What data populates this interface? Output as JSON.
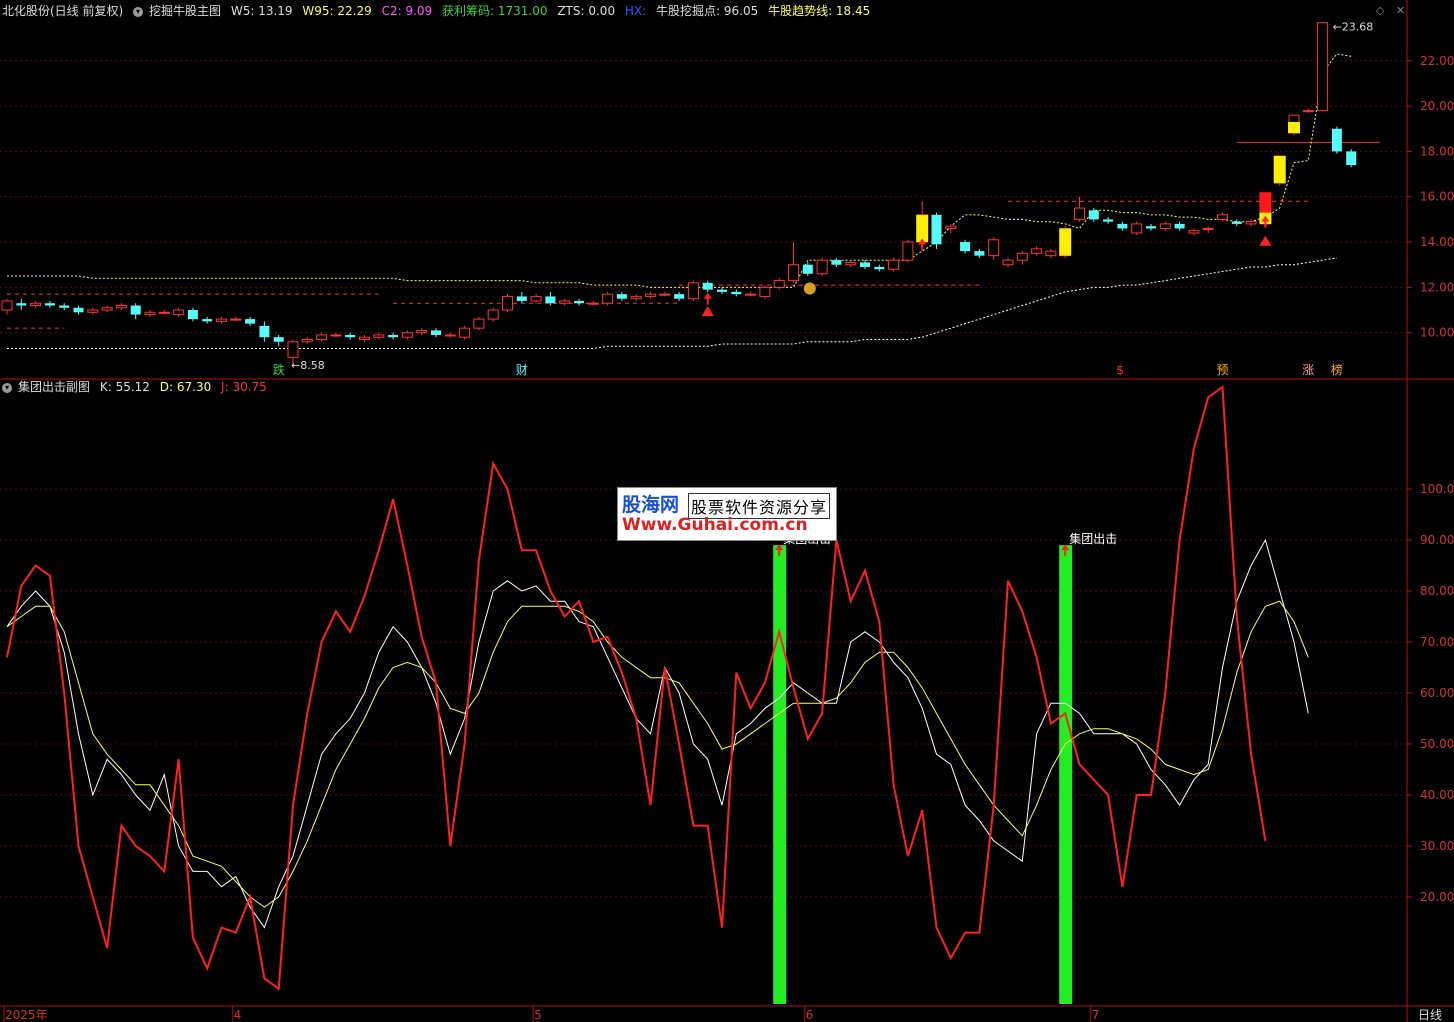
{
  "main_header": {
    "stock": "北化股份(日线 前复权)",
    "indicator": "挖掘牛股主图",
    "w5": "W5: 13.19",
    "w95": "W95: 22.29",
    "c2": "C2: 9.09",
    "chip": "获利筹码: 1731.00",
    "zts": "ZTS: 0.00",
    "hx": "HX: ",
    "dig": "牛股挖掘点: 96.05",
    "trend": "牛股趋势线: 18.45"
  },
  "sub_header": {
    "indicator": "集团出击副图",
    "k": "K: 55.12",
    "d": "D: 67.30",
    "j": "J: 30.75"
  },
  "colors": {
    "up": "#ff3030",
    "down": "#54fcfc",
    "k": "#ffffff",
    "d": "#ffff54",
    "j": "#ff2020",
    "signal": "#22ee22",
    "axis": "#b01010"
  },
  "main_axis": {
    "ticks": [
      "22.00",
      "20.00",
      "18.00",
      "16.00",
      "14.00",
      "12.00",
      "10.00"
    ],
    "values": [
      22,
      20,
      18,
      16,
      14,
      12,
      10
    ],
    "min": 8.0,
    "max": 23.8
  },
  "sub_axis": {
    "ticks": [
      "100.00",
      "90.00",
      "80.00",
      "70.00",
      "60.00",
      "50.00",
      "40.00",
      "30.00",
      "20.00"
    ],
    "values": [
      100,
      90,
      80,
      70,
      60,
      50,
      40,
      30,
      20
    ],
    "min": -1,
    "max": 121
  },
  "x_axis": {
    "labels": [
      "2025年",
      "4",
      "5",
      "6",
      "7"
    ],
    "label_index": [
      0,
      16,
      37,
      56,
      76
    ],
    "period": "日线"
  },
  "annotations": {
    "high": "23.68",
    "low": "8.58",
    "signal": "集团出击"
  },
  "markers": [
    {
      "index": 19,
      "text": "跌",
      "color": "#3cd23c"
    },
    {
      "index": 36,
      "text": "财",
      "color": "#54fcfc"
    },
    {
      "index": 78,
      "text": "$",
      "color": "#ff3030"
    },
    {
      "index": 85,
      "text": "预",
      "color": "#ffb000"
    },
    {
      "index": 91,
      "text": "涨",
      "color": "#ff9090"
    },
    {
      "index": 93,
      "text": "榜",
      "color": "#ffb000"
    }
  ],
  "logo": {
    "brand": "股海网",
    "slogan": "股票软件资源分享",
    "url": "Www.Guhai.com.cn"
  },
  "chart_data": [
    {
      "type": "candlestick",
      "title": "挖掘牛股主图",
      "candles": [
        [
          11.0,
          11.4,
          11.5,
          10.8
        ],
        [
          11.3,
          11.2,
          11.5,
          11.0
        ],
        [
          11.2,
          11.3,
          11.4,
          11.1
        ],
        [
          11.3,
          11.2,
          11.4,
          11.1
        ],
        [
          11.2,
          11.1,
          11.3,
          11.0
        ],
        [
          11.1,
          10.9,
          11.2,
          10.8
        ],
        [
          10.9,
          11.0,
          11.1,
          10.8
        ],
        [
          11.0,
          11.1,
          11.2,
          10.9
        ],
        [
          11.1,
          11.2,
          11.3,
          11.0
        ],
        [
          11.2,
          10.8,
          11.3,
          10.6
        ],
        [
          10.8,
          10.9,
          11.0,
          10.7
        ],
        [
          10.9,
          10.9,
          11.0,
          10.8
        ],
        [
          10.8,
          11.0,
          11.1,
          10.7
        ],
        [
          11.0,
          10.6,
          11.1,
          10.5
        ],
        [
          10.6,
          10.5,
          10.7,
          10.4
        ],
        [
          10.5,
          10.6,
          10.7,
          10.4
        ],
        [
          10.6,
          10.6,
          10.7,
          10.5
        ],
        [
          10.6,
          10.4,
          10.7,
          10.3
        ],
        [
          10.3,
          9.8,
          10.5,
          9.6
        ],
        [
          9.8,
          9.6,
          9.9,
          9.4
        ],
        [
          8.9,
          9.6,
          9.7,
          8.6
        ],
        [
          9.6,
          9.7,
          9.8,
          9.5
        ],
        [
          9.7,
          9.9,
          10.0,
          9.6
        ],
        [
          9.9,
          9.9,
          10.0,
          9.8
        ],
        [
          9.9,
          9.8,
          10.0,
          9.7
        ],
        [
          9.7,
          9.8,
          9.9,
          9.6
        ],
        [
          9.8,
          9.9,
          10.0,
          9.7
        ],
        [
          9.9,
          9.8,
          10.0,
          9.7
        ],
        [
          9.8,
          10.0,
          10.1,
          9.7
        ],
        [
          10.0,
          10.1,
          10.2,
          9.9
        ],
        [
          10.1,
          9.9,
          10.2,
          9.8
        ],
        [
          9.9,
          9.9,
          10.0,
          9.8
        ],
        [
          9.8,
          10.2,
          10.3,
          9.7
        ],
        [
          10.2,
          10.6,
          10.7,
          10.1
        ],
        [
          10.6,
          11.0,
          11.1,
          10.5
        ],
        [
          11.0,
          11.6,
          11.7,
          10.9
        ],
        [
          11.6,
          11.4,
          11.8,
          11.3
        ],
        [
          11.4,
          11.6,
          11.7,
          11.3
        ],
        [
          11.6,
          11.3,
          11.8,
          11.2
        ],
        [
          11.3,
          11.4,
          11.5,
          11.2
        ],
        [
          11.4,
          11.3,
          11.5,
          11.2
        ],
        [
          11.3,
          11.3,
          11.4,
          11.2
        ],
        [
          11.3,
          11.7,
          11.8,
          11.2
        ],
        [
          11.7,
          11.5,
          11.8,
          11.4
        ],
        [
          11.5,
          11.6,
          11.7,
          11.4
        ],
        [
          11.6,
          11.7,
          11.8,
          11.5
        ],
        [
          11.7,
          11.7,
          11.8,
          11.6
        ],
        [
          11.7,
          11.5,
          11.8,
          11.4
        ],
        [
          11.5,
          12.2,
          12.3,
          11.4
        ],
        [
          12.2,
          11.9,
          12.3,
          11.8
        ],
        [
          11.9,
          11.8,
          12.0,
          11.7
        ],
        [
          11.8,
          11.7,
          11.9,
          11.6
        ],
        [
          11.7,
          11.7,
          11.8,
          11.6
        ],
        [
          11.6,
          12.0,
          12.1,
          11.5
        ],
        [
          12.0,
          12.3,
          12.4,
          11.9
        ],
        [
          12.3,
          13.0,
          14.0,
          12.2
        ],
        [
          13.0,
          12.6,
          13.1,
          12.5
        ],
        [
          12.6,
          13.2,
          13.3,
          12.5
        ],
        [
          13.2,
          13.0,
          13.3,
          12.9
        ],
        [
          13.0,
          13.1,
          13.2,
          12.9
        ],
        [
          13.1,
          12.9,
          13.2,
          12.8
        ],
        [
          12.9,
          12.8,
          13.0,
          12.7
        ],
        [
          12.8,
          13.2,
          13.3,
          12.7
        ],
        [
          13.2,
          14.0,
          14.1,
          13.1
        ],
        [
          14.0,
          15.2,
          15.8,
          13.9
        ],
        [
          15.2,
          13.9,
          15.3,
          13.7
        ],
        [
          14.6,
          14.7,
          14.8,
          14.4
        ],
        [
          14.0,
          13.6,
          14.1,
          13.5
        ],
        [
          13.6,
          13.4,
          13.7,
          13.3
        ],
        [
          13.4,
          14.1,
          14.2,
          13.2
        ],
        [
          13.0,
          13.2,
          13.3,
          12.9
        ],
        [
          13.2,
          13.5,
          13.6,
          13.0
        ],
        [
          13.5,
          13.7,
          13.8,
          13.4
        ],
        [
          13.4,
          13.6,
          13.7,
          13.3
        ],
        [
          13.4,
          14.6,
          14.7,
          13.3
        ],
        [
          15.0,
          15.5,
          16.0,
          14.9
        ],
        [
          15.4,
          15.0,
          15.5,
          14.9
        ],
        [
          15.0,
          14.9,
          15.1,
          14.8
        ],
        [
          14.8,
          14.6,
          14.9,
          14.5
        ],
        [
          14.4,
          14.8,
          14.9,
          14.3
        ],
        [
          14.7,
          14.6,
          14.8,
          14.5
        ],
        [
          14.6,
          14.8,
          14.9,
          14.5
        ],
        [
          14.8,
          14.6,
          14.9,
          14.5
        ],
        [
          14.4,
          14.5,
          14.6,
          14.3
        ],
        [
          14.6,
          14.6,
          14.7,
          14.4
        ],
        [
          15.0,
          15.2,
          15.3,
          14.9
        ],
        [
          14.9,
          14.8,
          15.0,
          14.7
        ],
        [
          14.8,
          14.9,
          15.0,
          14.7
        ],
        [
          14.8,
          16.0,
          16.1,
          14.8
        ],
        [
          16.6,
          17.8,
          17.8,
          16.5
        ],
        [
          19.0,
          19.6,
          19.6,
          18.7
        ],
        [
          19.8,
          19.8,
          19.9,
          19.7
        ],
        [
          19.8,
          23.68,
          23.68,
          19.8
        ],
        [
          19.0,
          18.0,
          19.1,
          17.9
        ],
        [
          18.0,
          17.4,
          18.1,
          17.3
        ]
      ],
      "x_labels": [
        "2025年",
        "4",
        "5",
        "6",
        "7"
      ],
      "y_range": [
        8.0,
        23.8
      ],
      "trend_line": [
        12.5,
        12.5,
        12.5,
        12.5,
        12.5,
        12.5,
        12.4,
        12.4,
        12.4,
        12.4,
        12.4,
        12.4,
        12.4,
        12.4,
        12.4,
        12.4,
        12.4,
        12.4,
        12.4,
        12.4,
        12.4,
        12.4,
        12.4,
        12.4,
        12.4,
        12.4,
        12.4,
        12.4,
        12.3,
        12.3,
        12.3,
        12.3,
        12.3,
        12.3,
        12.3,
        12.3,
        12.3,
        12.2,
        12.2,
        12.2,
        12.2,
        12.1,
        12.1,
        12.1,
        12.1,
        12.0,
        12.0,
        12.0,
        12.0,
        12.0,
        12.0,
        12.0,
        12.0,
        12.0,
        12.0,
        12.0,
        13.2,
        13.2,
        13.2,
        13.2,
        13.2,
        13.2,
        13.2,
        13.2,
        13.6,
        14.0,
        14.7,
        15.2,
        15.2,
        15.1,
        15.0,
        15.0,
        14.9,
        14.9,
        14.8,
        14.6,
        15.4,
        15.4,
        15.3,
        15.3,
        15.2,
        15.2,
        15.1,
        15.1,
        15.0,
        15.0,
        14.9,
        14.9,
        15.1,
        15.5,
        17.5,
        17.6,
        21.5,
        22.3,
        22.2,
        null
      ],
      "support_line": [
        9.3,
        9.3,
        9.3,
        9.3,
        9.3,
        9.3,
        9.3,
        9.3,
        9.3,
        9.3,
        9.3,
        9.3,
        9.3,
        9.3,
        9.3,
        9.3,
        9.3,
        9.3,
        9.3,
        9.3,
        9.3,
        9.3,
        9.3,
        9.3,
        9.3,
        9.3,
        9.3,
        9.3,
        9.3,
        9.3,
        9.3,
        9.3,
        9.3,
        9.3,
        9.3,
        9.3,
        9.3,
        9.3,
        9.3,
        9.3,
        9.3,
        9.3,
        9.4,
        9.4,
        9.4,
        9.4,
        9.4,
        9.4,
        9.4,
        9.4,
        9.5,
        9.5,
        9.5,
        9.5,
        9.5,
        9.5,
        9.6,
        9.6,
        9.6,
        9.6,
        9.7,
        9.7,
        9.7,
        9.7,
        9.8,
        10.0,
        10.2,
        10.4,
        10.6,
        10.8,
        11.0,
        11.2,
        11.4,
        11.6,
        11.8,
        11.9,
        12.0,
        12.0,
        12.1,
        12.1,
        12.2,
        12.3,
        12.4,
        12.5,
        12.6,
        12.7,
        12.8,
        12.9,
        12.9,
        13.0,
        13.0,
        13.1,
        13.2,
        13.3,
        null,
        null
      ],
      "price_lines": [
        {
          "y": 11.7,
          "from": 0,
          "to": 26
        },
        {
          "y": 10.2,
          "from": 0,
          "to": 4
        },
        {
          "y": 11.3,
          "from": 27,
          "to": 47
        },
        {
          "y": 12.1,
          "from": 47,
          "to": 68
        },
        {
          "y": 15.8,
          "from": 70,
          "to": 91
        },
        {
          "y": 18.4,
          "from": 86,
          "to": 96,
          "solid": true
        }
      ],
      "highlight_bars": [
        {
          "index": 64,
          "color": "#ffee00"
        },
        {
          "index": 74,
          "color": "#ffee00"
        },
        {
          "index": 88,
          "color": "#ff1818",
          "open": 16.2,
          "close": 15.3
        },
        {
          "index": 88,
          "color": "#ffee00",
          "open": 15.3,
          "close": 14.8
        },
        {
          "index": 89,
          "color": "#ffee00"
        },
        {
          "index": 90,
          "color": "#ffee00",
          "open": 18.8,
          "close": 19.3
        }
      ],
      "triangles": [
        {
          "index": 49,
          "y": 11.0
        },
        {
          "index": 88,
          "y": 14.1
        }
      ],
      "up_arrows": [
        {
          "index": 49,
          "y": 11.5
        },
        {
          "index": 64,
          "y": 13.9
        },
        {
          "index": 88,
          "y": 14.9
        }
      ]
    },
    {
      "type": "line",
      "title": "集团出击副图",
      "series": [
        {
          "name": "K",
          "color": "#ffffff",
          "values": [
            73,
            77,
            80,
            77,
            68,
            52,
            40,
            47,
            44,
            40,
            37,
            44,
            30,
            25,
            25,
            22,
            24,
            18,
            14,
            22,
            28,
            38,
            48,
            52,
            55,
            60,
            68,
            73,
            70,
            65,
            58,
            48,
            55,
            70,
            80,
            82,
            80,
            81,
            78,
            78,
            74,
            73,
            67,
            61,
            55,
            52,
            65,
            60,
            50,
            47,
            38,
            52,
            54,
            57,
            59,
            62,
            60,
            58,
            58,
            70,
            72,
            70,
            66,
            63,
            57,
            48,
            46,
            38,
            35,
            31,
            29,
            27,
            52,
            58,
            58,
            56,
            52,
            52,
            52,
            50,
            45,
            42,
            38,
            43,
            46,
            65,
            78,
            85,
            90,
            80,
            70,
            56
          ]
        },
        {
          "name": "D",
          "color": "#ffff54",
          "values": [
            73,
            75,
            77,
            77,
            72,
            62,
            52,
            48,
            45,
            42,
            42,
            38,
            34,
            28,
            27,
            26,
            23,
            20,
            18,
            20,
            25,
            31,
            38,
            45,
            50,
            55,
            61,
            65,
            66,
            65,
            62,
            57,
            56,
            60,
            68,
            74,
            77,
            77,
            77,
            77,
            76,
            74,
            70,
            67,
            65,
            63,
            63,
            62,
            58,
            54,
            49,
            50,
            52,
            54,
            56,
            58,
            58,
            58,
            59,
            62,
            66,
            68,
            68,
            65,
            61,
            56,
            51,
            46,
            42,
            38,
            35,
            32,
            38,
            45,
            50,
            52,
            53,
            53,
            52,
            51,
            49,
            46,
            45,
            44,
            45,
            53,
            64,
            72,
            77,
            78,
            74,
            67
          ]
        },
        {
          "name": "J",
          "color": "#ff2020",
          "values": [
            67,
            81,
            85,
            83,
            60,
            30,
            20,
            10,
            34,
            30,
            28,
            25,
            47,
            12,
            6,
            14,
            13,
            20,
            4,
            2,
            38,
            56,
            70,
            76,
            72,
            79,
            88,
            98,
            85,
            71,
            62,
            30,
            50,
            86,
            105,
            100,
            88,
            88,
            80,
            75,
            78,
            70,
            71,
            64,
            55,
            38,
            65,
            50,
            34,
            34,
            14,
            64,
            57,
            62,
            72,
            61,
            51,
            56,
            90,
            78,
            84,
            74,
            42,
            28,
            37,
            14,
            8,
            13,
            13,
            38,
            82,
            76,
            67,
            54,
            56,
            46,
            43,
            40,
            22,
            40,
            40,
            60,
            90,
            108,
            118,
            120,
            75,
            48,
            31
          ]
        }
      ],
      "y_range": [
        -1,
        121
      ],
      "signal_bars": [
        54,
        74
      ],
      "signal_label": "集团出击"
    }
  ]
}
